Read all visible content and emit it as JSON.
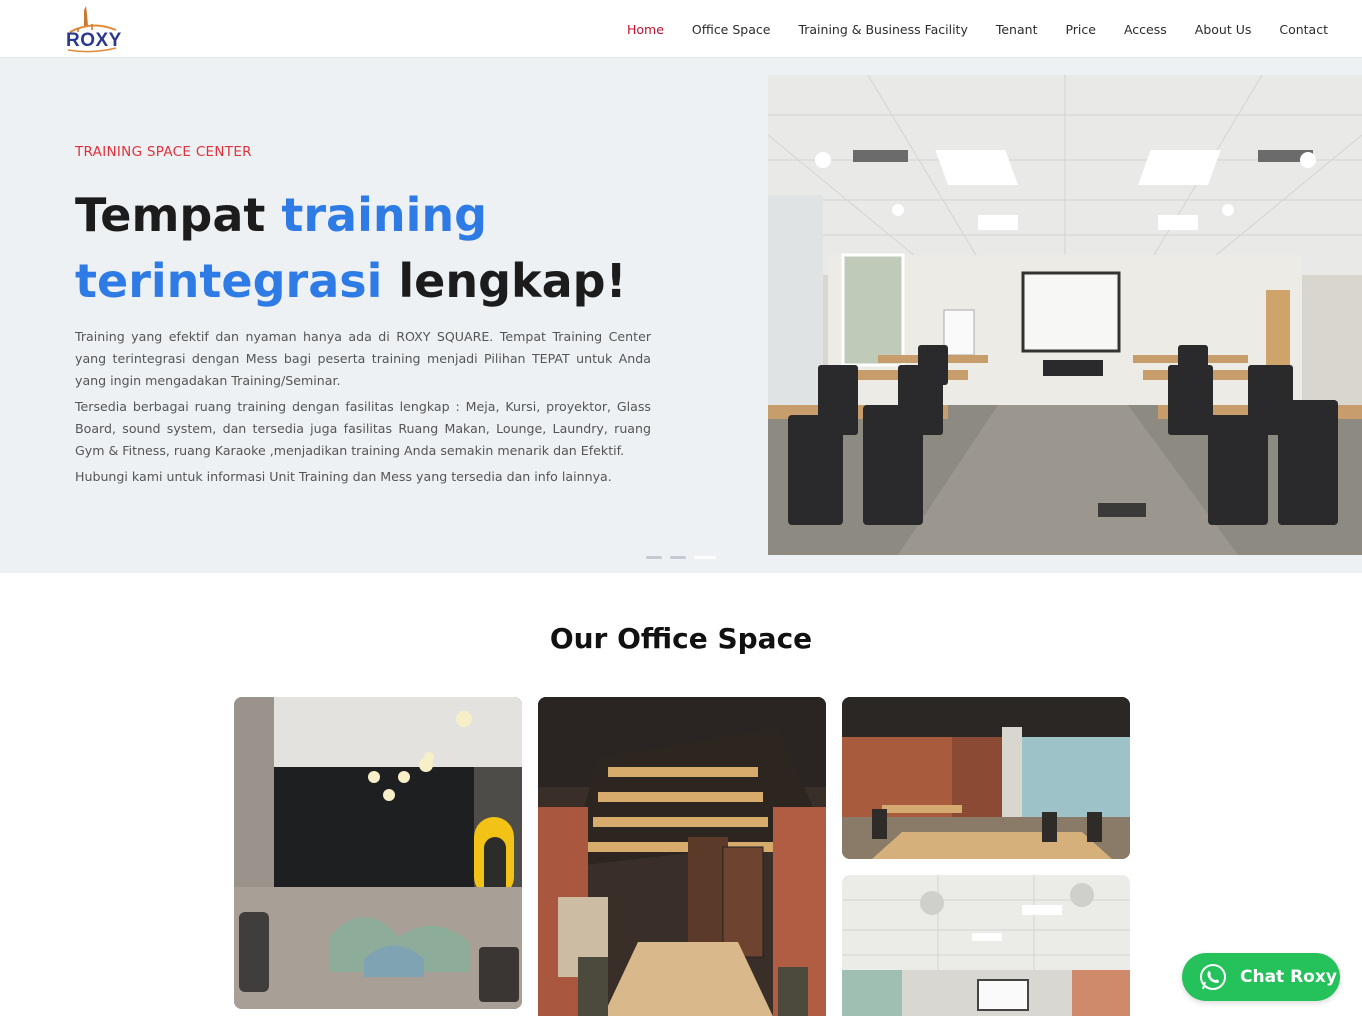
{
  "header": {
    "logo_text": "ROXY",
    "nav": [
      {
        "label": "Home",
        "active": true
      },
      {
        "label": "Office Space"
      },
      {
        "label": "Training & Business Facility"
      },
      {
        "label": "Tenant"
      },
      {
        "label": "Price"
      },
      {
        "label": "Access"
      },
      {
        "label": "About Us"
      },
      {
        "label": "Contact"
      }
    ]
  },
  "hero": {
    "eyebrow": "TRAINING SPACE CENTER",
    "headline_part1": "Tempat ",
    "headline_part2": "training",
    "headline_part3": "terintegrasi",
    "headline_part4": " lengkap!",
    "paragraphs": [
      "Training yang efektif dan nyaman hanya ada di ROXY SQUARE. Tempat Training Center yang terintegrasi dengan Mess bagi peserta training menjadi Pilihan TEPAT untuk Anda yang ingin mengadakan Training/Seminar.",
      "Tersedia berbagai ruang training dengan fasilitas lengkap : Meja, Kursi, proyektor, Glass Board, sound system, dan tersedia juga fasilitas Ruang Makan, Lounge, Laundry, ruang Gym & Fitness, ruang Karaoke ,menjadikan training Anda semakin menarik dan Efektif.",
      "Hubungi kami untuk informasi Unit Training dan Mess yang tersedia dan info lainnya."
    ],
    "slider_count": 3,
    "slider_active": 3,
    "image_icon": "training-room-photo"
  },
  "office": {
    "title": "Our Office Space"
  },
  "chat": {
    "label": "Chat Roxy",
    "icon": "whatsapp-icon"
  },
  "colors": {
    "accent_red": "#c8102e",
    "accent_blue": "#2e7be6",
    "chat_green": "#25c15a",
    "hero_bg": "#eef1f4"
  }
}
